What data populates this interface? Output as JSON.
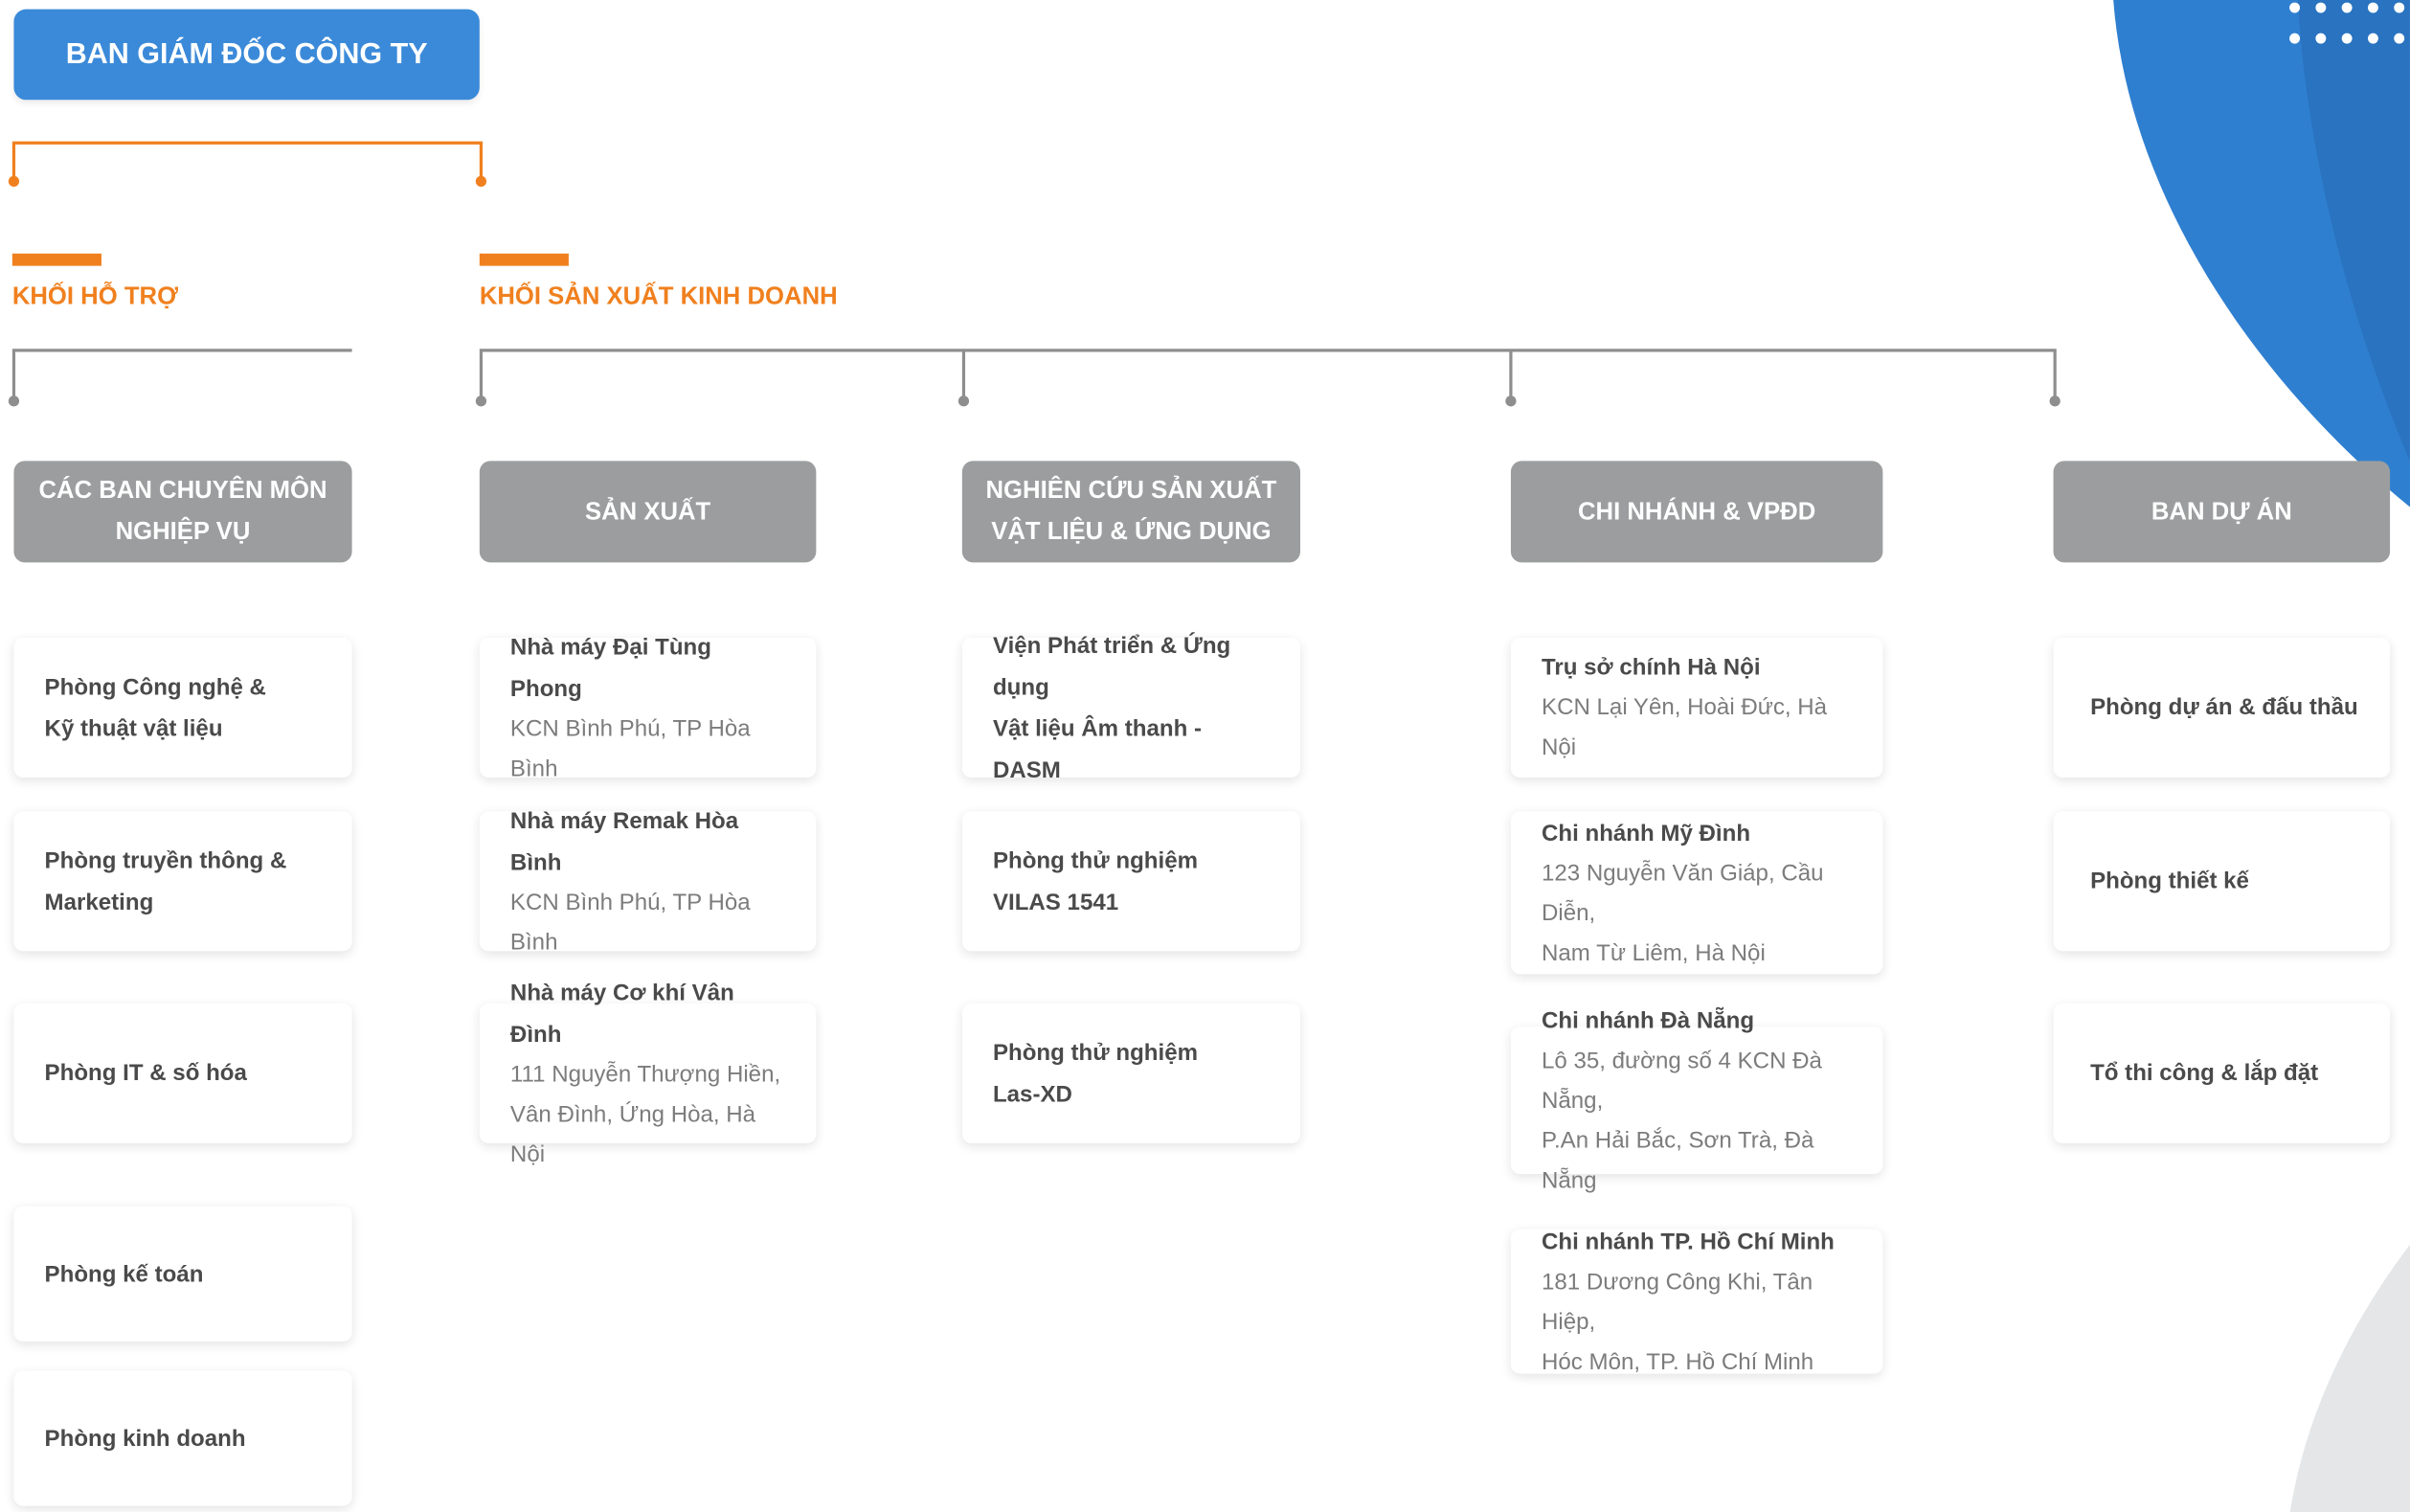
{
  "top": {
    "title": "BAN GIÁM ĐỐC CÔNG TY"
  },
  "groups": {
    "support": {
      "label": "KHỐI HỖ TRỢ"
    },
    "business": {
      "label": "KHỐI SẢN XUẤT KINH DOANH"
    }
  },
  "columns": [
    {
      "head": [
        "CÁC BAN CHUYÊN MÔN",
        "NGHIỆP VỤ"
      ],
      "cards": [
        {
          "title": [
            "Phòng Công nghệ &",
            "Kỹ thuật vật liệu"
          ],
          "sub": []
        },
        {
          "title": [
            "Phòng truyền thông &",
            "Marketing"
          ],
          "sub": []
        },
        {
          "title": [
            "Phòng IT & số hóa"
          ],
          "sub": []
        },
        {
          "title": [
            "Phòng kế toán"
          ],
          "sub": []
        },
        {
          "title": [
            "Phòng kinh doanh"
          ],
          "sub": []
        }
      ]
    },
    {
      "head": [
        "SẢN XUẤT"
      ],
      "cards": [
        {
          "title": [
            "Nhà máy Đại Tùng Phong"
          ],
          "sub": [
            "KCN Bình Phú, TP Hòa Bình"
          ]
        },
        {
          "title": [
            "Nhà máy Remak Hòa Bình"
          ],
          "sub": [
            "KCN Bình Phú, TP Hòa Bình"
          ]
        },
        {
          "title": [
            "Nhà máy Cơ khí Vân Đình"
          ],
          "sub": [
            "111 Nguyễn Thượng Hiền,",
            "Vân Đình, Ứng Hòa, Hà Nội"
          ]
        }
      ]
    },
    {
      "head": [
        "NGHIÊN CỨU SẢN XUẤT",
        "VẬT LIỆU & ỨNG DỤNG"
      ],
      "cards": [
        {
          "title": [
            "Viện Phát triển & Ứng dụng",
            "Vật liệu Âm thanh - DASM"
          ],
          "sub": []
        },
        {
          "title": [
            "Phòng thử nghiệm",
            "VILAS 1541"
          ],
          "sub": []
        },
        {
          "title": [
            "Phòng thử nghiệm",
            "Las-XD"
          ],
          "sub": []
        }
      ]
    },
    {
      "head": [
        "CHI NHÁNH & VPĐD"
      ],
      "cards": [
        {
          "title": [
            "Trụ sở chính Hà Nội"
          ],
          "sub": [
            "KCN Lại Yên, Hoài Đức, Hà Nội"
          ]
        },
        {
          "title": [
            "Chi nhánh Mỹ Đình"
          ],
          "sub": [
            "123 Nguyễn Văn Giáp, Cầu Diễn,",
            "Nam Từ Liêm, Hà Nội"
          ]
        },
        {
          "title": [
            "Chi nhánh Đà Nẵng"
          ],
          "sub": [
            "Lô 35, đường số 4 KCN Đà Nẵng,",
            "P.An Hải Bắc, Sơn Trà, Đà Nẵng"
          ]
        },
        {
          "title": [
            "Chi nhánh TP. Hồ Chí Minh"
          ],
          "sub": [
            "181 Dương Công Khi, Tân Hiệp,",
            "Hóc Môn, TP. Hồ Chí Minh"
          ]
        }
      ]
    },
    {
      "head": [
        "BAN DỰ ÁN"
      ],
      "cards": [
        {
          "title": [
            "Phòng dự án & đấu thầu"
          ],
          "sub": []
        },
        {
          "title": [
            "Phòng thiết kế"
          ],
          "sub": []
        },
        {
          "title": [
            "Tổ thi công & lắp đặt"
          ],
          "sub": []
        }
      ]
    }
  ],
  "colors": {
    "accent_blue": "#3b8ad9",
    "accent_orange": "#f0801e",
    "header_gray": "#9b9d9e",
    "line_gray": "#8e8e8e",
    "deco_blue": "#2f7fd0"
  }
}
